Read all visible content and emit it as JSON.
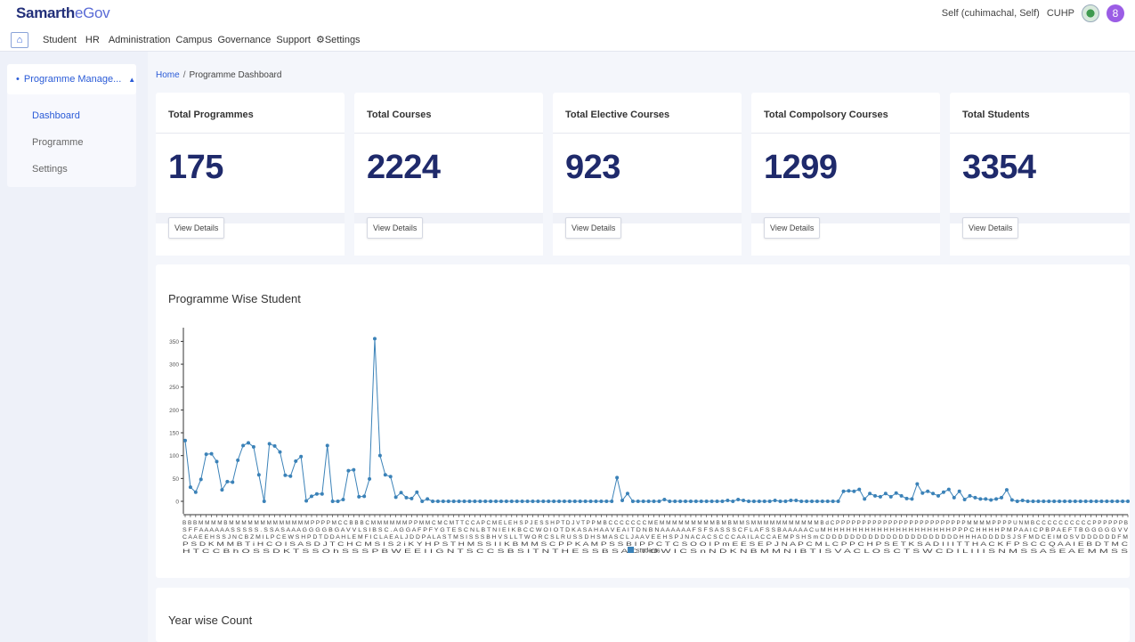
{
  "app": {
    "brand_main": "Samarth",
    "brand_sub": "eGov"
  },
  "user": {
    "label": "Self (cuhimachal, Self)",
    "org": "CUHP",
    "avatar_glyph": "8"
  },
  "nav": {
    "items": [
      "Student",
      "HR",
      "Administration",
      "Campus",
      "Governance",
      "Support",
      "⚙Settings"
    ]
  },
  "sidebar": {
    "section": "Programme Manage...",
    "items": [
      {
        "label": "Dashboard",
        "active": true
      },
      {
        "label": "Programme",
        "active": false
      },
      {
        "label": "Settings",
        "active": false
      }
    ]
  },
  "breadcrumb": {
    "home": "Home",
    "separator": "/",
    "current": "Programme Dashboard"
  },
  "stats": [
    {
      "title": "Total Programmes",
      "value": "175",
      "button": "View Details"
    },
    {
      "title": "Total Courses",
      "value": "2224",
      "button": "View Details"
    },
    {
      "title": "Total Elective Courses",
      "value": "923",
      "button": "View Details"
    },
    {
      "title": "Total Compolsory Courses",
      "value": "1299",
      "button": "View Details"
    },
    {
      "title": "Total Students",
      "value": "3354",
      "button": "View Details"
    }
  ],
  "chart_section": {
    "title": "Programme Wise Student"
  },
  "year_section": {
    "title": "Year wise Count"
  },
  "colors": {
    "line": "#3b82b8",
    "value_text": "#1f2a6b",
    "accent": "#2a5bd7"
  },
  "chart_data": {
    "type": "line",
    "series": [
      {
        "name": "students",
        "values": [
          133,
          31,
          20,
          48,
          103,
          104,
          87,
          25,
          43,
          42,
          90,
          122,
          128,
          119,
          58,
          0,
          126,
          121,
          108,
          57,
          55,
          88,
          98,
          1,
          11,
          16,
          16,
          122,
          0,
          0,
          4,
          67,
          69,
          10,
          11,
          49,
          356,
          100,
          58,
          54,
          9,
          19,
          8,
          6,
          20,
          0,
          5,
          0,
          0,
          0,
          0,
          0,
          0,
          0,
          0,
          0,
          0,
          0,
          0,
          0,
          0,
          0,
          0,
          0,
          0,
          0,
          0,
          0,
          0,
          0,
          0,
          0,
          0,
          0,
          0,
          0,
          0,
          0,
          0,
          0,
          0,
          0,
          52,
          2,
          17,
          0,
          0,
          0,
          0,
          0,
          0,
          4,
          0,
          0,
          0,
          0,
          0,
          0,
          0,
          0,
          0,
          0,
          0,
          2,
          0,
          4,
          2,
          0,
          0,
          0,
          0,
          0,
          2,
          0,
          0,
          2,
          2,
          0,
          0,
          0,
          0,
          0,
          0,
          0,
          0,
          22,
          23,
          22,
          26,
          5,
          17,
          12,
          10,
          17,
          10,
          18,
          12,
          6,
          5,
          38,
          18,
          22,
          17,
          12,
          20,
          26,
          8,
          22,
          4,
          12,
          8,
          5,
          5,
          3,
          5,
          8,
          25,
          3,
          0,
          2,
          0,
          0,
          0,
          0,
          0,
          0,
          0,
          0,
          0,
          0,
          0,
          0,
          0,
          0,
          0,
          0,
          0,
          0,
          0,
          0
        ]
      }
    ],
    "y_ticks": [
      0,
      50,
      100,
      150,
      200,
      250,
      300,
      350
    ],
    "ylim": [
      0,
      380
    ],
    "x_label_rows": [
      "B B B M M M M B M M M M M M M M M M M M M P P P P M C C B B B C M M M M M M P P M M C M C M T T C C A P C M E L E H S P J E S S H P T D J V T P P M B C C C C C C C M E M M M M M M M M M B M B M M S M M M M M M M M M M M B d C P P P P P P P P P P P P P P P P P P P P P P P P P M M M M P P P P U N M B C C C C C C C C C C P P P P P P B",
      "S F F A A A A A A S S S S S . S S A S A A A G G G G B G A V V L S I B S C . A G G A F P F Y G T E S C N L B T N I E I K B C C W O I O T D K A S A H A A V E A I T D N B N A A A A A A F S F S A S S S C F L A F S S B A A A A A C u M H H H H H H H H H H H H H H H H H H H H P P P C H H H H P M P A A I C P B P A E F T B G G G G G V V",
      "C A A E E H S S J N C B Z M I L P C E W S H P D T D D A H L E M F I C L A E A L J D D P A L A S T M S I S S S B H V S L L T   W O R C S L R U S   S D H S M A S C L J A A V E E H S P J N A C A C S C C C A A I L A C C A E M P S H S m C D D D D D D D D D D D D D D D D D D D D D D H H H A D D D D S   J S   F M D C E I M O S V D D D D D D F M",
      "P   S D       K M M B       T i   H C   O I S A S D J T C   H C M S   I   S 2 i K Y H   P   S         T         H                                                                   M S       S   I   I K B M M S C P P K A M P S S B I P P C T C S O O I P m   E E S E P J N A P C M L C P P C H P S E T K S A D I I I   T T H A C   K F   P S C   C Q       A A I E B D T M C",
      "H                 T C C B             h     O     S     S   D K T           S     S     O h S S S                       P                                                                   B         W           E E I I G N T S C C S B S I T N T H E S S B S A C T O W I C S   n   N D K N B M M N I B T I S V A C L O S C T S W C D I L I   I I S N M     S S     A S   E A             E M   M S S"
    ],
    "legend": "students"
  }
}
